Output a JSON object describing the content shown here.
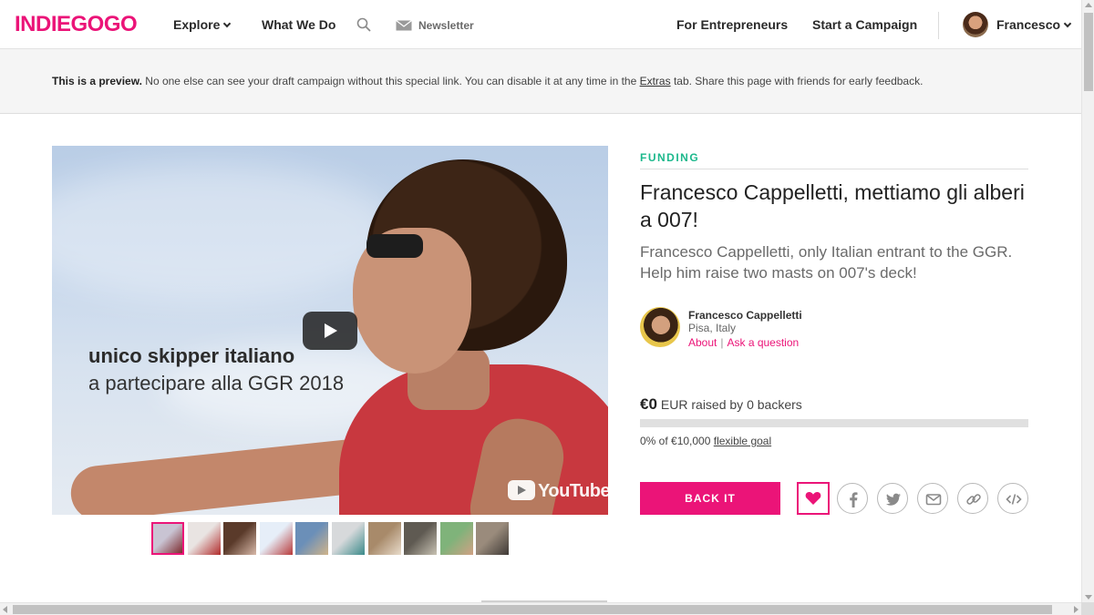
{
  "header": {
    "logo": "INDIEGOGO",
    "nav": {
      "explore": "Explore",
      "what_we_do": "What We Do",
      "newsletter": "Newsletter",
      "for_entrepreneurs": "For Entrepreneurs",
      "start_campaign": "Start a Campaign",
      "user": "Francesco"
    }
  },
  "banner": {
    "bold": "This is a preview.",
    "text_before_link": " No one else can see your draft campaign without this special link. You can disable it at any time in the ",
    "link": "Extras",
    "text_after_link": " tab. Share this page with friends for early feedback."
  },
  "video": {
    "overlay_line1": "unico skipper italiano",
    "overlay_line2": "a partecipare alla GGR 2018",
    "provider": "YouTube"
  },
  "gallery": {
    "active_index": 0,
    "thumbnails": [
      {
        "color_a": "#c9c4d3",
        "color_b": "#7d2b2e"
      },
      {
        "color_a": "#e9e4e2",
        "color_b": "#b12a2a"
      },
      {
        "color_a": "#5a3a2a",
        "color_b": "#d8b9a9"
      },
      {
        "color_a": "#e6eef8",
        "color_b": "#b83a3a"
      },
      {
        "color_a": "#6b8fb8",
        "color_b": "#d0b48a"
      },
      {
        "color_a": "#d7d9db",
        "color_b": "#3a8a8a"
      },
      {
        "color_a": "#a88a6a",
        "color_b": "#e9dccb"
      },
      {
        "color_a": "#5f5a52",
        "color_b": "#c8c2b3"
      },
      {
        "color_a": "#7fb37a",
        "color_b": "#d0a184"
      },
      {
        "color_a": "#9a8b7c",
        "color_b": "#3f3a36"
      }
    ]
  },
  "campaign": {
    "section_label": "FUNDING",
    "title": "Francesco Cappelletti, mettiamo gli alberi a 007!",
    "tagline": "Francesco Cappelletti, only Italian entrant to the GGR. Help him raise two masts on 007's deck!",
    "owner": {
      "name": "Francesco Cappelletti",
      "location": "Pisa, Italy",
      "about_link": "About",
      "ask_link": "Ask a question"
    },
    "funding": {
      "amount": "€0",
      "raised_text": "EUR raised by 0 backers",
      "progress_fraction": 0,
      "goal_prefix": "0% of €10,000",
      "goal_link": "flexible goal"
    },
    "back_button": "BACK IT"
  },
  "colors": {
    "brand_pink": "#eb1478",
    "funding_green": "#1cb88c"
  },
  "icons": [
    "search-icon",
    "mail-icon",
    "chevron-down-icon",
    "heart-icon",
    "facebook-icon",
    "twitter-icon",
    "email-icon",
    "link-icon",
    "embed-icon",
    "play-icon"
  ]
}
